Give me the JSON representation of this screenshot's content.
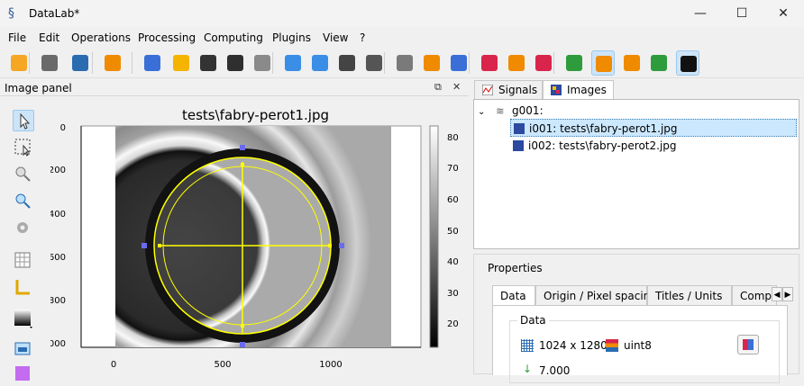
{
  "window": {
    "title": "DataLab*",
    "minimize": "—",
    "maximize": "☐",
    "close": "✕"
  },
  "menu": [
    "File",
    "Edit",
    "Operations",
    "Processing",
    "Computing",
    "Plugins",
    "View",
    "?"
  ],
  "toolbar": {
    "buttons": [
      {
        "name": "open-hdf5-icon",
        "color": "#f5a623"
      },
      {
        "name": "save-hdf5-icon",
        "color": "#6a6a6a"
      },
      {
        "name": "browse-hdf5-icon",
        "color": "#2b6cb0"
      },
      {
        "name": "settings-icon",
        "color": "#f08a00"
      },
      {
        "name": "new-image-icon",
        "color": "#3a6fd8"
      },
      {
        "name": "open-image-icon",
        "color": "#f5b400"
      },
      {
        "name": "save-image-icon",
        "color": "#333333"
      },
      {
        "name": "stack-icon",
        "color": "#2f2f2f"
      },
      {
        "name": "layers-icon",
        "color": "#8a8a8a"
      },
      {
        "name": "move-up-icon",
        "color": "#3a8ee6"
      },
      {
        "name": "move-down-icon",
        "color": "#3a8ee6"
      },
      {
        "name": "duplicate-icon",
        "color": "#444444"
      },
      {
        "name": "delete-icon",
        "color": "#555555"
      },
      {
        "name": "transfer-icon",
        "color": "#7a7a7a"
      },
      {
        "name": "copy-metadata-icon",
        "color": "#f08a00"
      },
      {
        "name": "paste-metadata-icon",
        "color": "#3a6fd8"
      },
      {
        "name": "import-icon",
        "color": "#d9254c"
      },
      {
        "name": "export-icon",
        "color": "#f08a00"
      },
      {
        "name": "remove-icon",
        "color": "#d9254c"
      },
      {
        "name": "annotations-icon",
        "color": "#2e9c3c"
      },
      {
        "name": "roi-icon",
        "color": "#f08a00"
      },
      {
        "name": "refresh-icon",
        "color": "#f08a00"
      },
      {
        "name": "comment-icon",
        "color": "#2e9c3c"
      },
      {
        "name": "contrast-icon",
        "color": "#111111"
      }
    ]
  },
  "image_panel": {
    "title": "Image panel",
    "float": "⧉",
    "close": "✕"
  },
  "plot": {
    "title": "tests\\fabry-perot1.jpg",
    "x_ticks": [
      "0",
      "500",
      "1000"
    ],
    "y_ticks": [
      "0",
      "200",
      "400",
      "600",
      "800",
      "1000"
    ],
    "colorbar_ticks": [
      "80",
      "70",
      "60",
      "50",
      "40",
      "30",
      "20"
    ]
  },
  "tabs": [
    {
      "label": "Signals",
      "selected": false
    },
    {
      "label": "Images",
      "selected": true
    }
  ],
  "tree": {
    "group": "g001:",
    "items": [
      {
        "label": "i001: tests\\fabry-perot1.jpg",
        "selected": true
      },
      {
        "label": "i002: tests\\fabry-perot2.jpg",
        "selected": false
      }
    ]
  },
  "properties": {
    "title": "Properties",
    "tabs": [
      "Data",
      "Origin / Pixel spacing",
      "Titles / Units",
      "Compu"
    ],
    "group_title": "Data",
    "size": "1024 x 1280",
    "dtype": "uint8",
    "next_value": "7.000"
  }
}
